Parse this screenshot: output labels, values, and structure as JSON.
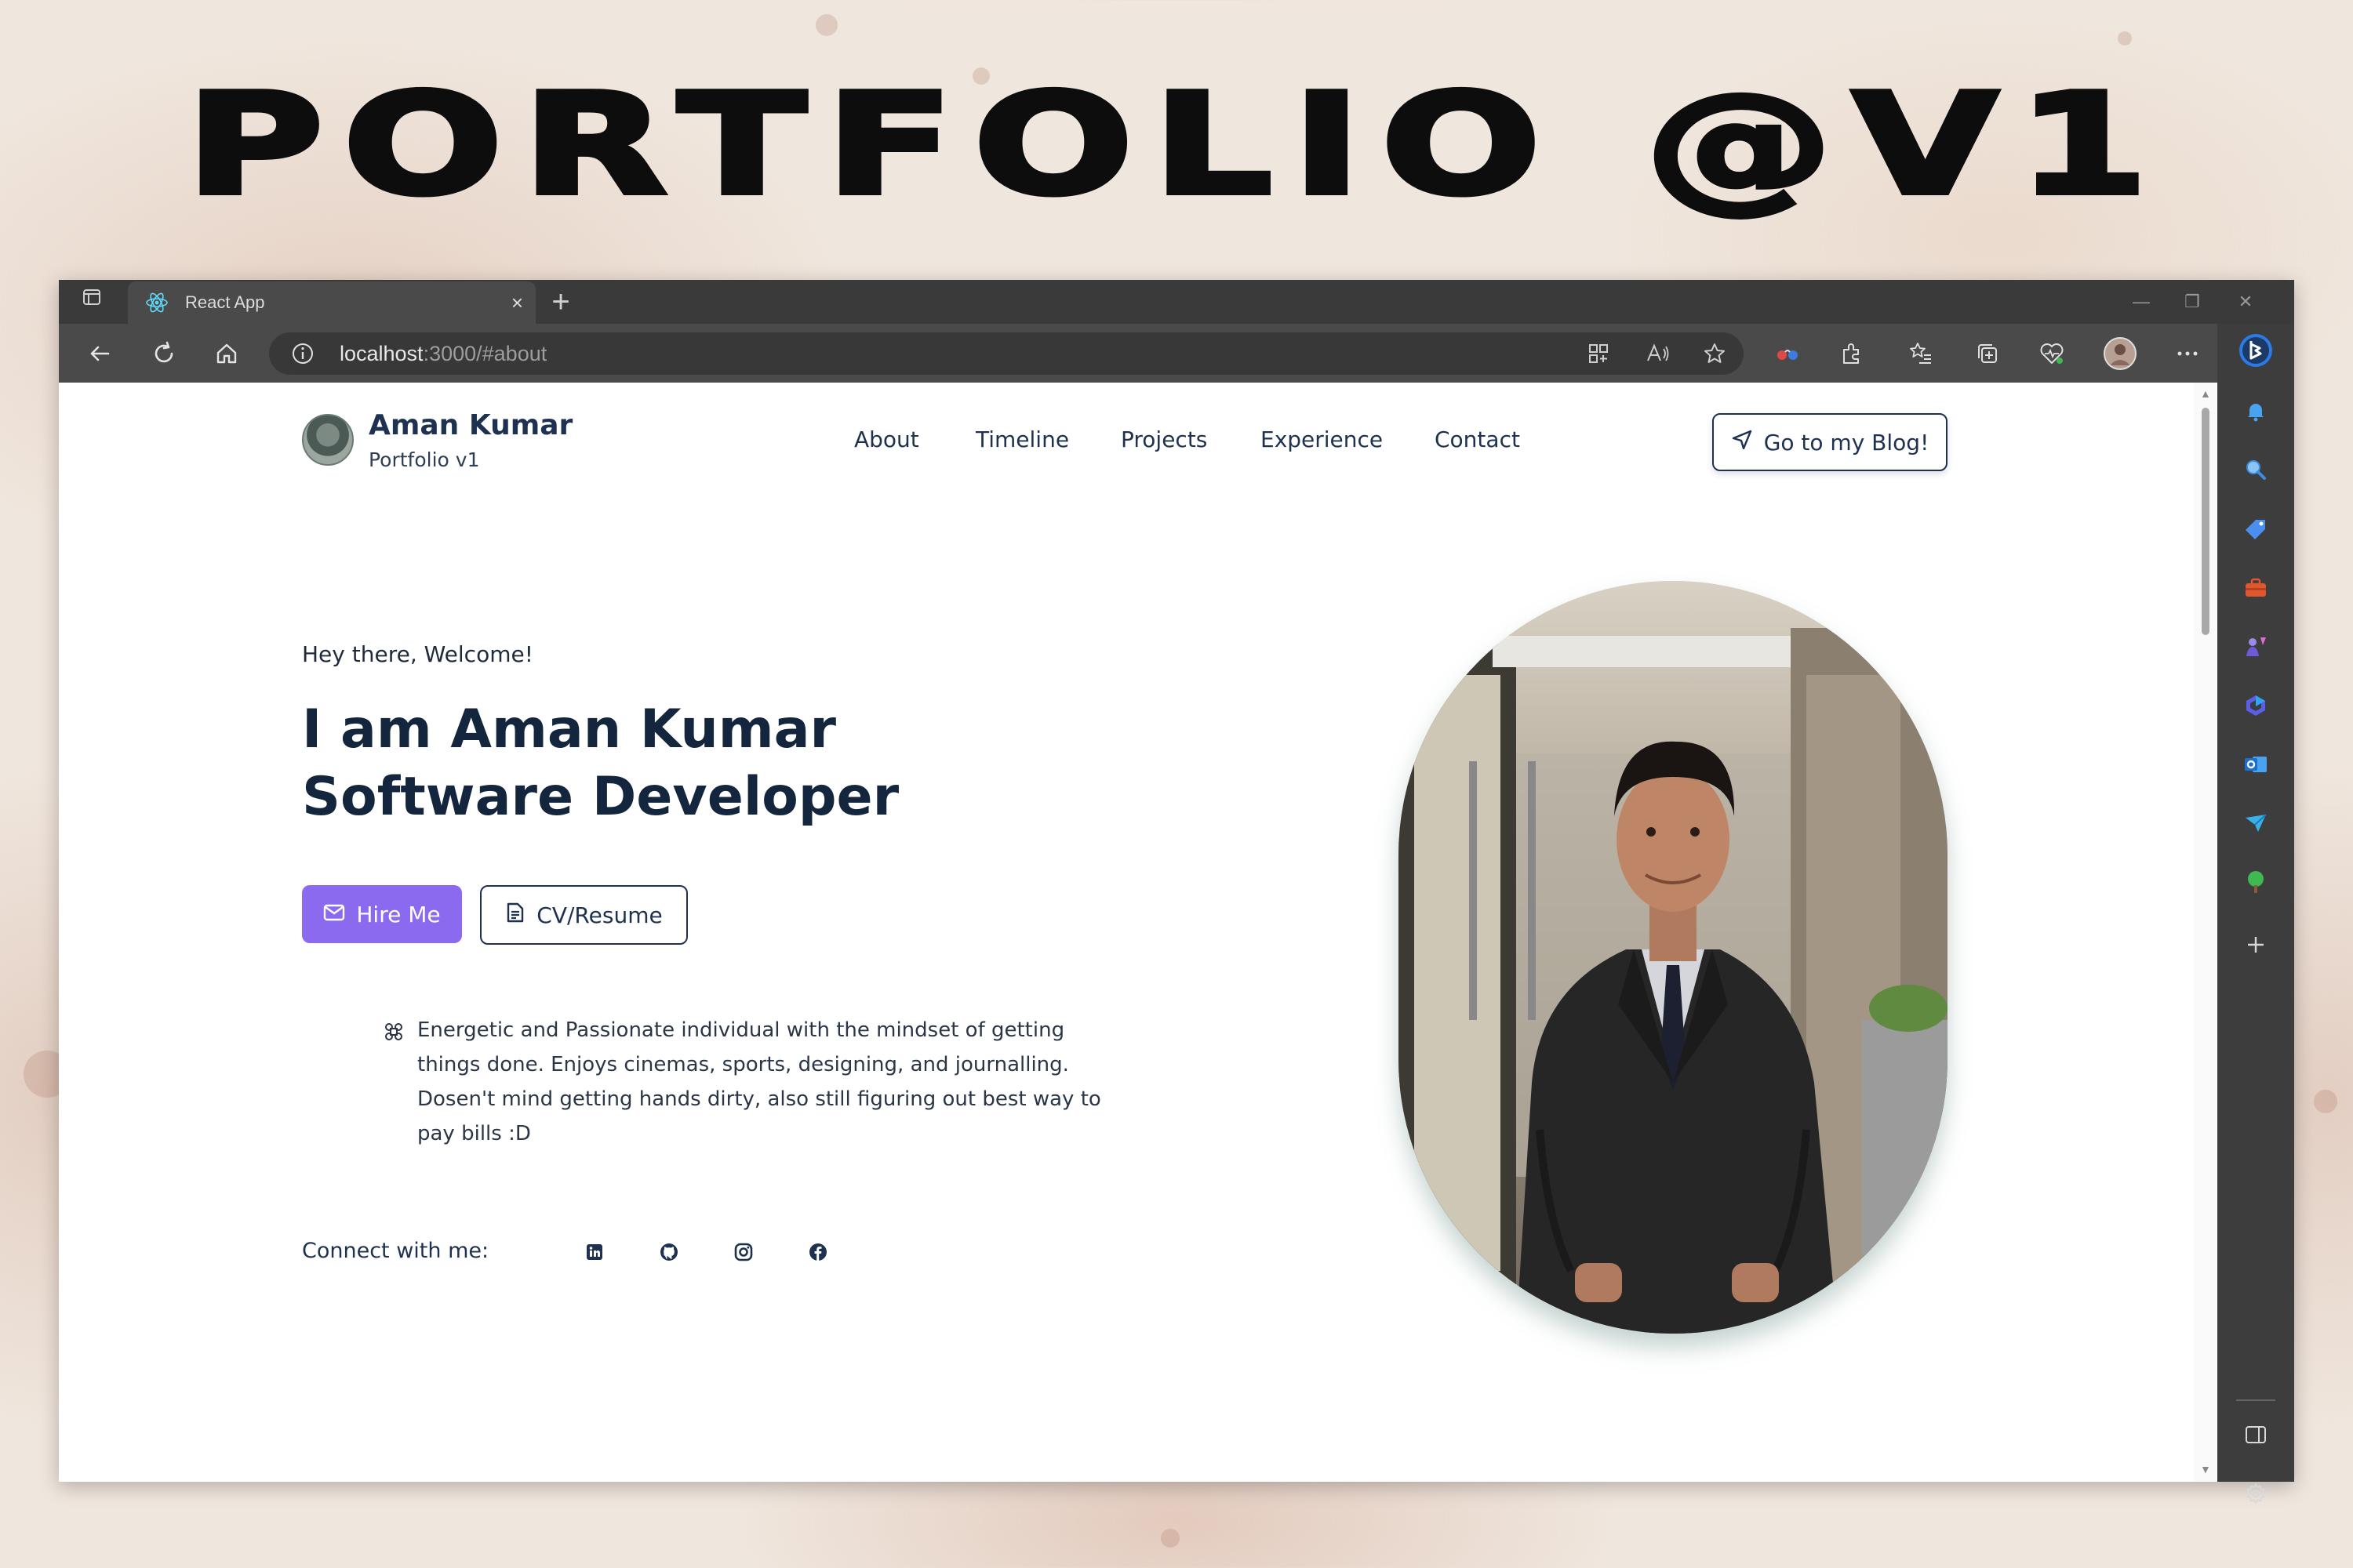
{
  "banner": {
    "title": "PORTFOLIO @V1"
  },
  "browser": {
    "tab_title": "React App",
    "url_host": "localhost",
    "url_rest": ":3000/#about"
  },
  "site": {
    "brand_name": "Aman Kumar",
    "brand_sub": "Portfolio v1",
    "nav": [
      "About",
      "Timeline",
      "Projects",
      "Experience",
      "Contact"
    ],
    "blog_button": "Go to my Blog!"
  },
  "hero": {
    "greeting": "Hey there, Welcome!",
    "headline_line1": "I am Aman Kumar",
    "headline_line2": "Software Developer",
    "hire_button": "Hire Me",
    "cv_button": "CV/Resume",
    "bio": "Energetic and Passionate individual with the mindset of getting things done. Enjoys cinemas, sports, designing, and journalling. Dosen't mind getting hands dirty, also still figuring out best way to pay bills :D",
    "connect_label": "Connect with me:",
    "socials": [
      "linkedin-icon",
      "github-icon",
      "instagram-icon",
      "facebook-icon"
    ]
  },
  "colors": {
    "accent": "#8b6af0",
    "navy": "#1e3150",
    "edge_blue": "#2a7ae8"
  }
}
